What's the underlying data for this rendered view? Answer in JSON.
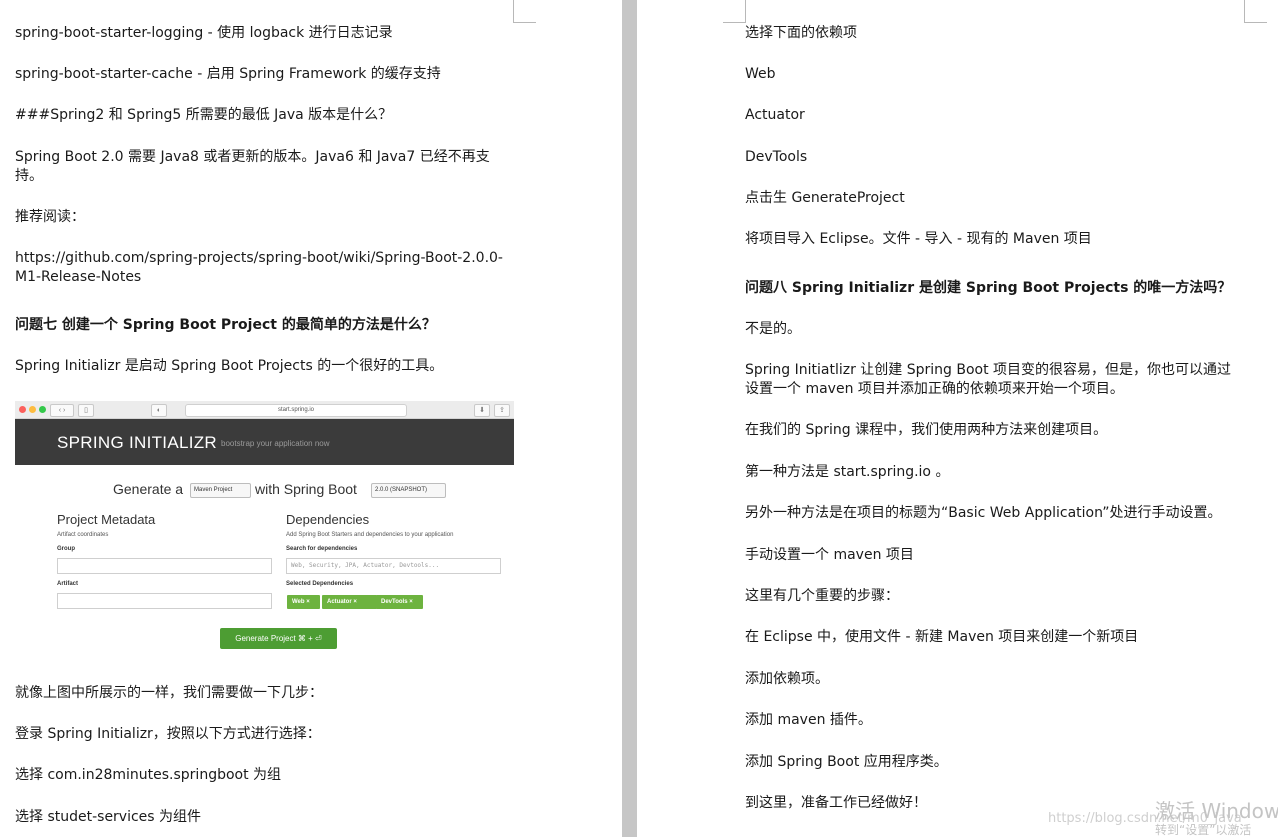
{
  "left": {
    "p1": "spring-boot-starter-logging - 使用 logback 进行日志记录",
    "p2": "spring-boot-starter-cache - 启用 Spring Framework 的缓存支持",
    "p3": "###Spring2 和 Spring5 所需要的最低 Java 版本是什么？",
    "p4": "Spring Boot 2.0 需要 Java8 或者更新的版本。Java6 和 Java7 已经不再支持。",
    "p5": "推荐阅读：",
    "p6": "https://github.com/spring-projects/spring-boot/wiki/Spring-Boot-2.0.0-M1-Release-Notes",
    "q7": "问题七 创建一个 Spring Boot Project 的最简单的方法是什么？",
    "p7": "Spring Initializr 是启动 Spring Boot Projects 的一个很好的工具。",
    "p8": "就像上图中所展示的一样，我们需要做一下几步：",
    "p9": "登录 Spring Initializr，按照以下方式进行选择：",
    "p10": "选择 com.in28minutes.springboot 为组",
    "p11": "选择 studet-services 为组件"
  },
  "screenshot": {
    "url": "start.spring.io",
    "brand": "SPRING INITIALIZR",
    "tagline": "bootstrap your application now",
    "generate_a": "Generate a",
    "project_type": "Maven Project",
    "with_spring_boot": "with Spring Boot",
    "boot_version": "2.0.0 (SNAPSHOT)",
    "metadata_title": "Project Metadata",
    "metadata_sub": "Artifact coordinates",
    "group_label": "Group",
    "artifact_label": "Artifact",
    "deps_title": "Dependencies",
    "deps_sub": "Add Spring Boot Starters and dependencies to your application",
    "search_label": "Search for dependencies",
    "search_placeholder": "Web, Security, JPA, Actuator, Devtools...",
    "selected_label": "Selected Dependencies",
    "chips": [
      "Web ×",
      "Actuator ×",
      "DevTools ×"
    ],
    "generate_button": "Generate Project  ⌘ + ⏎"
  },
  "right": {
    "r1": "选择下面的依赖项",
    "r2": "Web",
    "r3": "Actuator",
    "r4": "DevTools",
    "r5": "点击生 GenerateProject",
    "r6": "将项目导入 Eclipse。文件 - 导入 - 现有的 Maven 项目",
    "q8": "问题八 Spring Initializr 是创建 Spring Boot Projects 的唯一方法吗？",
    "r7": "不是的。",
    "r8": "Spring Initiatlizr 让创建 Spring Boot 项目变的很容易，但是，你也可以通过设置一个 maven 项目并添加正确的依赖项来开始一个项目。",
    "r9": "在我们的 Spring 课程中，我们使用两种方法来创建项目。",
    "r10": "第一种方法是 start.spring.io 。",
    "r11": "另外一种方法是在项目的标题为“Basic Web Application”处进行手动设置。",
    "r12": "手动设置一个 maven 项目",
    "r13": "这里有几个重要的步骤：",
    "r14": "在 Eclipse 中，使用文件 - 新建 Maven 项目来创建一个新项目",
    "r15": "添加依赖项。",
    "r16": "添加 maven 插件。",
    "r17": "添加 Spring Boot 应用程序类。",
    "r18": "到这里，准备工作已经做好！"
  },
  "overlay": {
    "blog_url": "https://blog.csdn.net/m0_java",
    "watermark": "激活 Window",
    "watermark_sub": "转到“设置”以激活"
  }
}
